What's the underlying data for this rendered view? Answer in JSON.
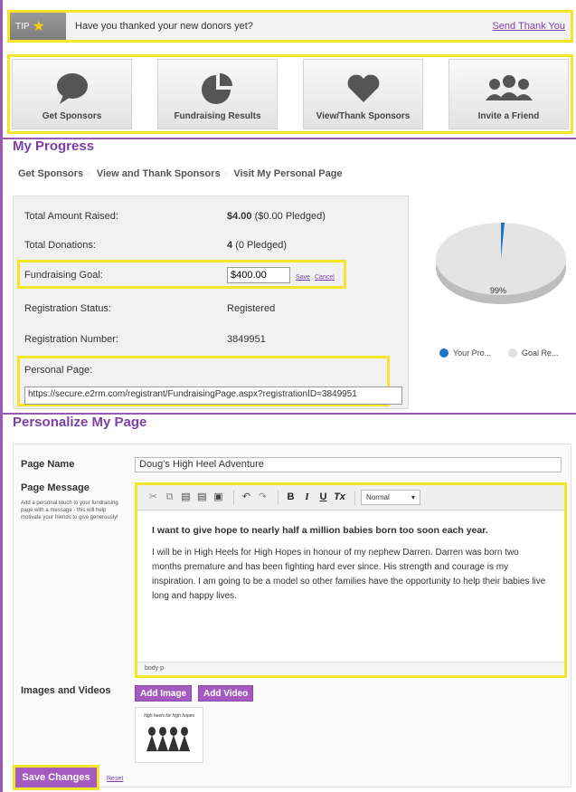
{
  "tip": {
    "badge": "TIP",
    "text": "Have you thanked your new donors yet?",
    "link": "Send Thank You"
  },
  "tiles": [
    {
      "label": "Get Sponsors",
      "icon": "speech-bubble-icon"
    },
    {
      "label": "Fundraising Results",
      "icon": "pie-chart-icon"
    },
    {
      "label": "View/Thank Sponsors",
      "icon": "heart-icon"
    },
    {
      "label": "Invite a Friend",
      "icon": "people-icon"
    }
  ],
  "progress": {
    "title": "My Progress",
    "subnav": [
      "Get Sponsors",
      "View and Thank Sponsors",
      "Visit My Personal Page"
    ],
    "rows": {
      "raised_label": "Total Amount Raised:",
      "raised_value": "$4.00",
      "raised_pledged": "($0.00 Pledged)",
      "donations_label": "Total Donations:",
      "donations_value": "4",
      "donations_pledged": "(0 Pledged)",
      "goal_label": "Fundraising Goal:",
      "goal_value": "$400.00",
      "goal_save": "Save",
      "goal_cancel": "Cancel",
      "status_label": "Registration Status:",
      "status_value": "Registered",
      "number_label": "Registration Number:",
      "number_value": "3849951",
      "page_label": "Personal Page:",
      "page_url": "https://secure.e2rm.com/registrant/FundraisingPage.aspx?registrationID=3849951"
    },
    "pie": {
      "percent_label": "99%",
      "legend_progress": "Your Pro...",
      "legend_goal": "Goal Re...",
      "progress_color": "#1e73c8",
      "goal_color": "#e0e0e0",
      "progress_fraction": 0.01
    }
  },
  "personalize": {
    "title": "Personalize My Page",
    "name_label": "Page Name",
    "name_value": "Doug's High Heel Adventure",
    "message_label": "Page Message",
    "message_help": "Add a personal touch to your fundraising page with a message - this will help motivate your friends to give generously!",
    "editor": {
      "format_select": "Normal",
      "headline": "I want to give hope to nearly half a million babies born too soon each year.",
      "body": "I will be in High Heels for High Hopes in honour of my nephew Darren.  Darren was born two months premature and has been fighting hard ever since.  His strength and courage is my inspiration.  I am going to be a model so other families have the opportunity to help their babies live long and happy lives.",
      "status_path": "body  p"
    },
    "media_label": "Images and Videos",
    "add_image": "Add Image",
    "add_video": "Add Video",
    "thumb_caption": "high heels for high hopes",
    "save": "Save Changes",
    "reset": "Reset"
  }
}
